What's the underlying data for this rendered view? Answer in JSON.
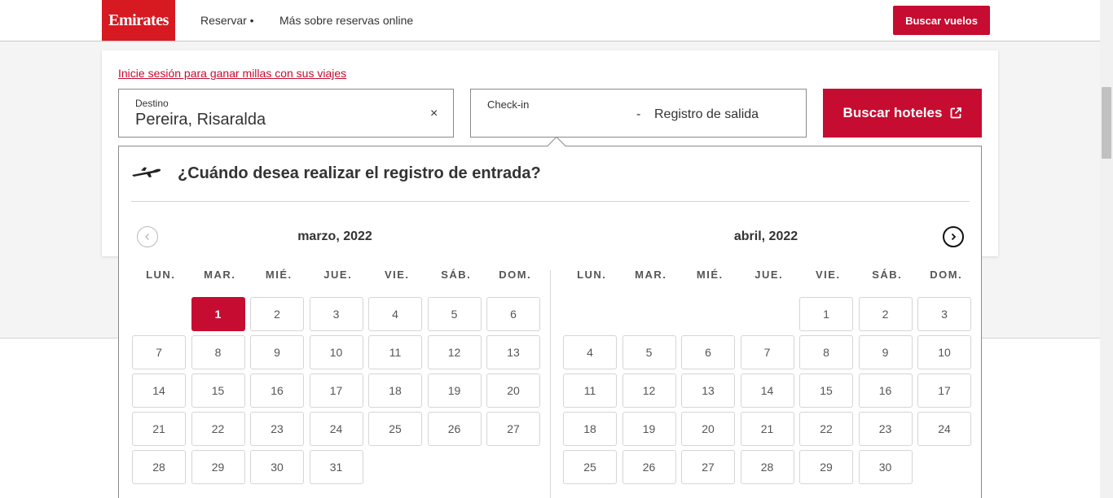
{
  "header": {
    "logo_text": "Emirates",
    "nav": [
      "Reservar •",
      "Más sobre reservas online"
    ],
    "search_flights_label": "Buscar vuelos"
  },
  "search": {
    "signin_link": "Inicie sesión para ganar millas con sus viajes",
    "destination_label": "Destino",
    "destination_value": "Pereira, Risaralda",
    "clear_symbol": "×",
    "checkin_label": "Check-in",
    "separator": "-",
    "checkout_placeholder": "Registro de salida",
    "search_hotels_label": "Buscar hoteles"
  },
  "calendar": {
    "heading": "¿Cuándo desea realizar el registro de entrada?",
    "weekdays": [
      "LUN.",
      "MAR.",
      "MIÉ.",
      "JUE.",
      "VIE.",
      "SÁB.",
      "DOM."
    ],
    "months": [
      {
        "title": "marzo, 2022",
        "offset": 1,
        "days": 31,
        "selected": 1
      },
      {
        "title": "abril, 2022",
        "offset": 4,
        "days": 30,
        "selected": null
      }
    ]
  },
  "colors": {
    "brand_red": "#d71921",
    "button_red": "#c60c30"
  },
  "icons": {
    "plane": "plane-icon",
    "prev": "chevron-left-icon",
    "next": "chevron-right-icon",
    "external": "external-link-icon"
  }
}
